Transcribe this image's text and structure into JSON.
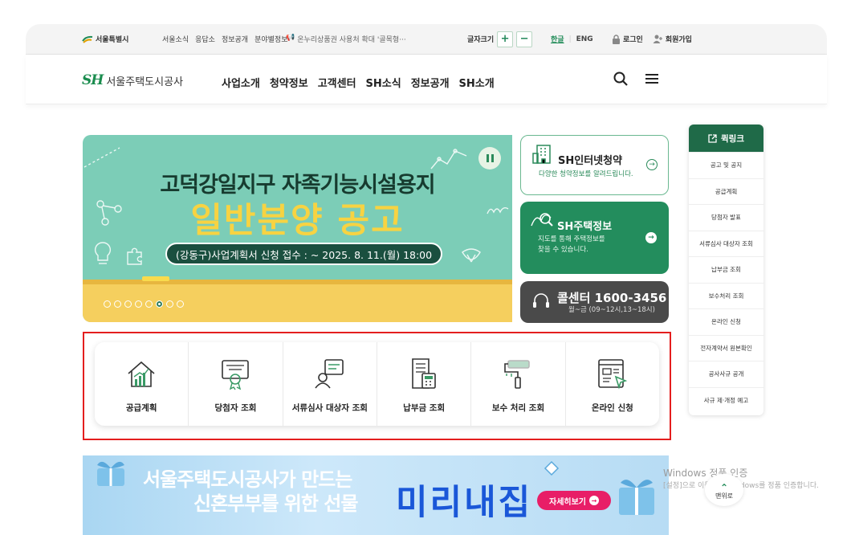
{
  "topbar": {
    "seoul_label": "서울특별시",
    "links": [
      "서울소식",
      "응답소",
      "정보공개",
      "분야별정보"
    ],
    "notice": "온누리상품권 사용처 확대 '골목형···",
    "font_size_label": "글자크기",
    "font_plus": "+",
    "font_minus": "−",
    "lang_ko": "한글",
    "lang_en": "ENG",
    "login": "로그인",
    "signup": "회원가입"
  },
  "header": {
    "logo_mark": "SH",
    "logo_text": "서울주택도시공사",
    "nav": [
      "사업소개",
      "청약정보",
      "고객센터",
      "SH소식",
      "정보공개",
      "SH소개"
    ]
  },
  "banner": {
    "title_line1": "고덕강일지구 자족기능시설용지",
    "title_line2": "일반분양 공고",
    "period": "(강동구)사업계획서 신청 접수 : ~ 2025. 8. 11.(월) 18:00",
    "slides_total": 8,
    "slide_current": 6
  },
  "cards": {
    "subscription": {
      "title": "SH인터넷청약",
      "desc": "다양한 청약정보를 알려드립니다."
    },
    "housing": {
      "title": "SH주택정보",
      "desc_line1": "지도를 통해 주택정보를",
      "desc_line2": "찾을 수 있습니다."
    },
    "callcenter": {
      "title": "콜센터 1600-3456",
      "hours": "월~금 (09~12시,13~18시)"
    }
  },
  "quicklink": {
    "title": "퀵링크",
    "items": [
      "공고 및 공지",
      "공급계획",
      "당첨자 발표",
      "서류심사 대상자 조회",
      "납부금 조회",
      "보수처리 조회",
      "온라인 신청",
      "전자계약서 원본확인",
      "공사사규 공개",
      "사규 제·개정 예고"
    ]
  },
  "services": [
    {
      "label": "공급계획",
      "icon": "house-chart-icon"
    },
    {
      "label": "당첨자 조회",
      "icon": "certificate-icon"
    },
    {
      "label": "서류심사 대상자 조회",
      "icon": "person-document-icon"
    },
    {
      "label": "납부금 조회",
      "icon": "calculator-document-icon"
    },
    {
      "label": "보수 처리 조회",
      "icon": "paint-roller-icon"
    },
    {
      "label": "온라인 신청",
      "icon": "web-form-icon"
    }
  ],
  "promo": {
    "line1": "서울주택도시공사가 만드는",
    "line2": "신혼부부를 위한 선물",
    "big": "미리내집",
    "more": "자세히보기"
  },
  "overlay": {
    "watermark_title": "Windows 정품 인증",
    "watermark_sub": "[설정]으로 이동하여 Windows를 정품 인증합니다.",
    "top_button": "맨위로"
  },
  "colors": {
    "brand_green": "#1f6a48",
    "accent_green": "#238d5d",
    "highlight_red": "#e41e1e",
    "banner_mint": "#7ccdb7",
    "banner_yellow": "#f7d342"
  }
}
